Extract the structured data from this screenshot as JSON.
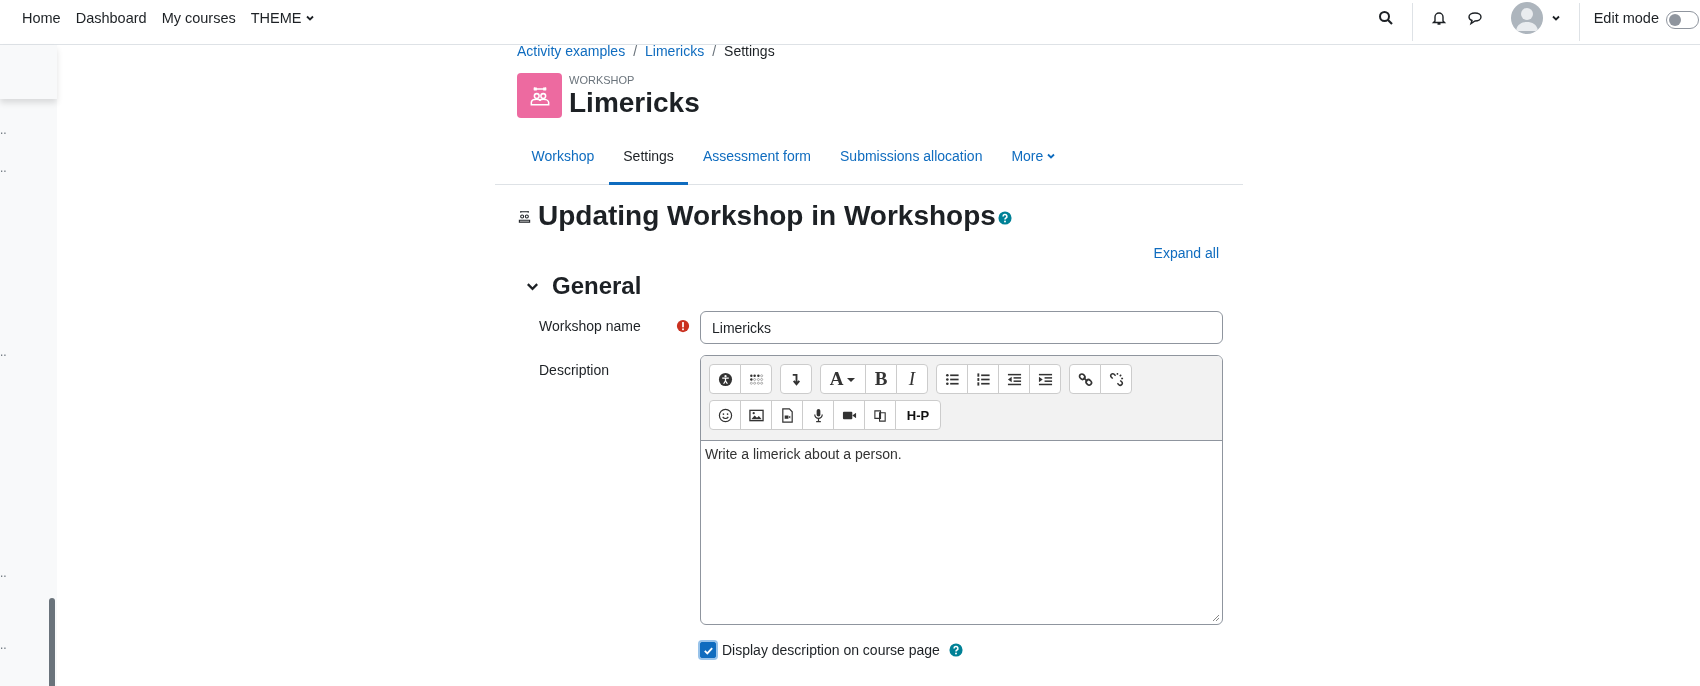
{
  "nav": [
    {
      "label": "Home",
      "has_menu": false
    },
    {
      "label": "Dashboard",
      "has_menu": false
    },
    {
      "label": "My courses",
      "has_menu": false
    },
    {
      "label": "THEME",
      "has_menu": true
    }
  ],
  "edit_mode": {
    "label": "Edit mode",
    "on": false
  },
  "sidebar": {
    "items": [
      "..",
      "..",
      "..",
      "..",
      ".."
    ]
  },
  "breadcrumb": [
    {
      "label": "Activity examples",
      "link": true
    },
    {
      "separator": "/",
      "label": "Limericks",
      "link": true
    },
    {
      "separator": "/",
      "label": "Settings",
      "link": false
    }
  ],
  "activity": {
    "type_label": "WORKSHOP",
    "title": "Limericks"
  },
  "tabs": [
    {
      "label": "Workshop",
      "selected": false,
      "has_menu": false
    },
    {
      "label": "Settings",
      "selected": true,
      "has_menu": false
    },
    {
      "label": "Assessment form",
      "selected": false,
      "has_menu": false
    },
    {
      "label": "Submissions allocation",
      "selected": false,
      "has_menu": false
    },
    {
      "label": "More",
      "selected": false,
      "has_menu": true
    }
  ],
  "page_title": "Updating Workshop in Workshops",
  "expand_all": "Expand all",
  "section": {
    "title": "General",
    "expanded": true
  },
  "name_field": {
    "label": "Workshop name",
    "value": "Limericks",
    "required": true
  },
  "description": {
    "label": "Description",
    "value": "Write a limerick about a person.",
    "toolbar": {
      "font": "A",
      "bold": "B",
      "italic": "I",
      "h5p": "H-P"
    }
  },
  "display_checkbox": {
    "label": "Display description on course page",
    "checked": true
  }
}
